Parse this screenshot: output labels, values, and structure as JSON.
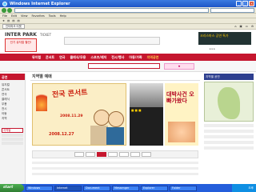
{
  "window": {
    "title": "Windows Internet Explorer"
  },
  "menu": [
    "File",
    "Edit",
    "View",
    "Favorites",
    "Tools",
    "Help"
  ],
  "browser_tab": {
    "label": "인터파크 티켓"
  },
  "site": {
    "logo": "INTER PARK",
    "logo_sub": "TICKET",
    "promo_left": "인기 뮤지컬 할인!",
    "promo_right": "크리스마스 공연 특가",
    "nav": [
      "뮤지컬",
      "콘서트",
      "연극",
      "클래식/무용",
      "스포츠/레저",
      "전시/행사",
      "아동/가족",
      "지역공연"
    ]
  },
  "sidebar": {
    "header": "공연",
    "items": [
      "뮤지컬",
      "콘서트",
      "연극",
      "클래식",
      "무용",
      "전시",
      "아동",
      "지역"
    ],
    "box_title": "지역별"
  },
  "main": {
    "title": "지역별 예매",
    "banner_title": "전국 콘서트",
    "banner_date1": "2008.11.29",
    "banner_date2": "2008.12.27",
    "poster_b_title": "대박사건 오빠가왔다"
  },
  "right_panel": {
    "title": "지역별 공연"
  },
  "taskbar": {
    "start": "start",
    "tasks": [
      "Windows",
      "Internet",
      "Document",
      "Messenger",
      "Explorer",
      "Folder"
    ],
    "clock": "오후"
  }
}
